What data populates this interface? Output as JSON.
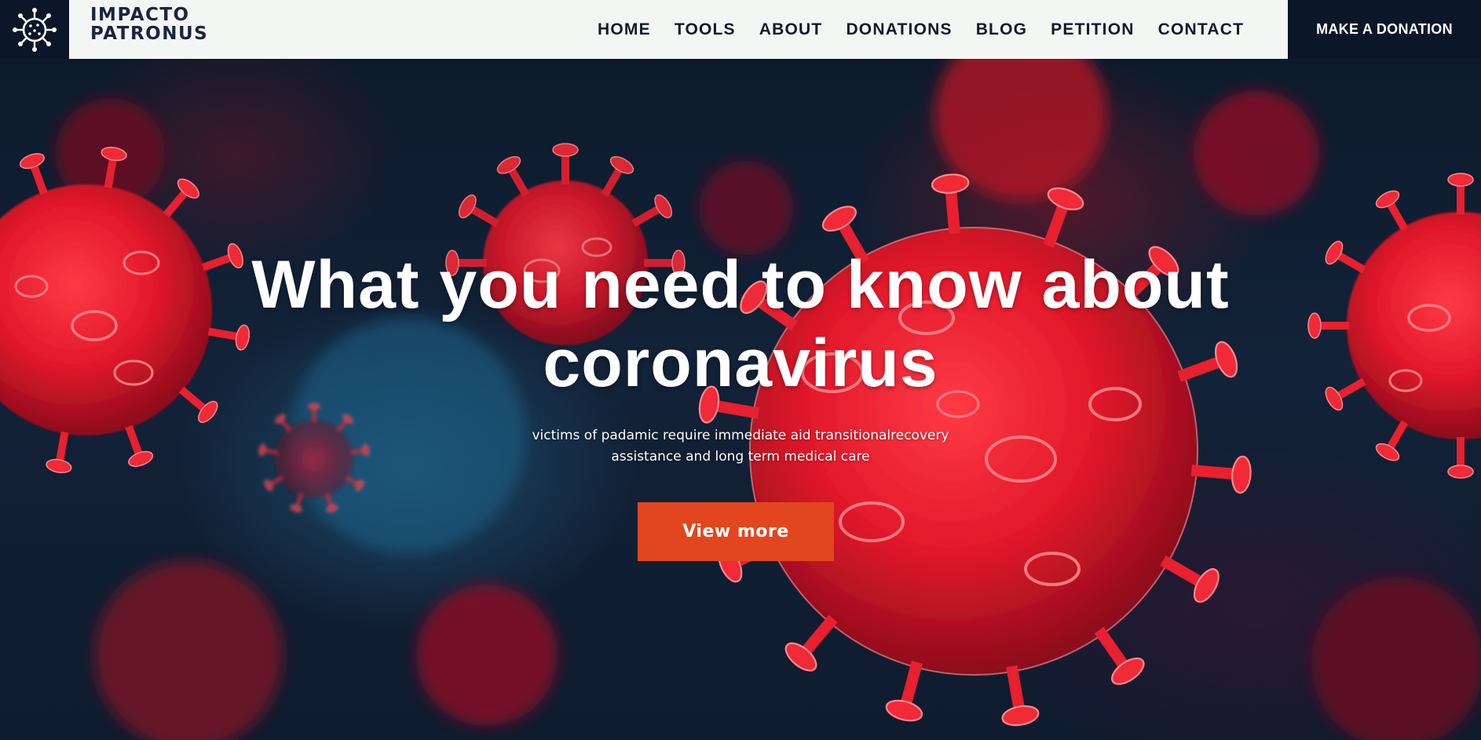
{
  "brand": {
    "line1": "IMPACTO",
    "line2": "PATRONUS",
    "logo_icon": "virus-icon"
  },
  "nav": {
    "items": [
      {
        "label": "HOME"
      },
      {
        "label": "TOOLS"
      },
      {
        "label": "ABOUT"
      },
      {
        "label": "DONATIONS"
      },
      {
        "label": "BLOG"
      },
      {
        "label": "PETITION"
      },
      {
        "label": "CONTACT"
      }
    ],
    "donate_label": "MAKE A DONATION"
  },
  "hero": {
    "title_line1": "What you need to know about",
    "title_line2": "coronavirus",
    "subtitle_line1": "victims of padamic require immediate aid transitionalrecovery",
    "subtitle_line2": "assistance and long term medical care",
    "button_label": "View more",
    "background": "red coronavirus particles on dark blue background"
  },
  "colors": {
    "header_bg": "#f4f6f3",
    "dark_navy": "#0b1628",
    "accent_orange": "#e2461f",
    "nav_text": "#111a2b",
    "virus_red": "#e0182a"
  }
}
